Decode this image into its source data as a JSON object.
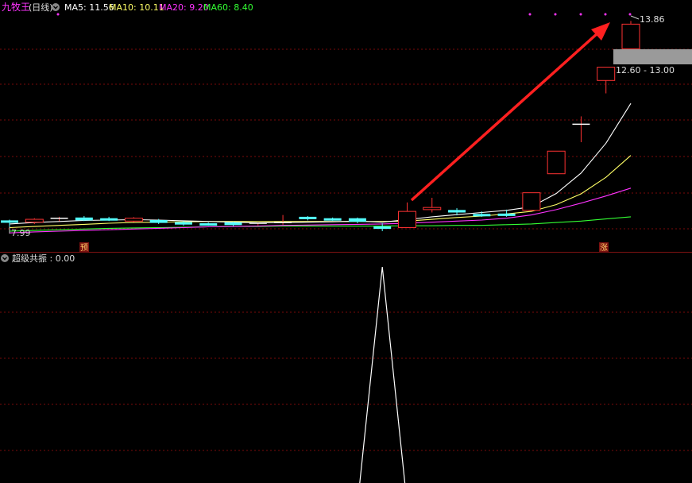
{
  "main_panel": {
    "stock_name": "九牧王",
    "period": "(日线)",
    "ma_labels": [
      {
        "text": "MA5: 11.56",
        "color": "#ffffff"
      },
      {
        "text": "MA10: 10.11",
        "color": "#ffff66"
      },
      {
        "text": "MA20: 9.20",
        "color": "#ff33ff"
      },
      {
        "text": "MA60: 8.40",
        "color": "#33ff33"
      }
    ],
    "high_label": "13.86",
    "low_label": "7.99",
    "range_label": "12.60 - 13.00",
    "marker_yu": "预",
    "marker_zhang": "涨"
  },
  "indicator_panel": {
    "title": "超级共振 : 0.00"
  },
  "colors": {
    "up": "#ff3232",
    "down": "#54ffff",
    "ma5": "#ffffff",
    "ma10": "#ffff66",
    "ma20": "#ff33ff",
    "ma60": "#33ff33",
    "grid": "#7a0a0a",
    "arrow": "#ff2020",
    "name": "#ff33ff"
  },
  "chart_data": [
    {
      "type": "candlestick",
      "price_axis_range": [
        7.8,
        14.0
      ],
      "candles": [
        {
          "o": 8.3,
          "c": 8.25,
          "h": 8.32,
          "l": 7.99
        },
        {
          "o": 8.25,
          "c": 8.33,
          "h": 8.36,
          "l": 8.2
        },
        {
          "o": 8.34,
          "c": 8.36,
          "h": 8.4,
          "l": 8.28
        },
        {
          "o": 8.38,
          "c": 8.3,
          "h": 8.42,
          "l": 8.28
        },
        {
          "o": 8.36,
          "c": 8.32,
          "h": 8.4,
          "l": 8.28
        },
        {
          "o": 8.28,
          "c": 8.36,
          "h": 8.39,
          "l": 8.25
        },
        {
          "o": 8.31,
          "c": 8.23,
          "h": 8.34,
          "l": 8.2
        },
        {
          "o": 8.25,
          "c": 8.2,
          "h": 8.28,
          "l": 8.15
        },
        {
          "o": 8.22,
          "c": 8.2,
          "h": 8.24,
          "l": 8.15
        },
        {
          "o": 8.24,
          "c": 8.17,
          "h": 8.26,
          "l": 8.14
        },
        {
          "o": 8.19,
          "c": 8.22,
          "h": 8.24,
          "l": 8.16
        },
        {
          "o": 8.22,
          "c": 8.24,
          "h": 8.45,
          "l": 8.18
        },
        {
          "o": 8.4,
          "c": 8.34,
          "h": 8.42,
          "l": 8.3
        },
        {
          "o": 8.36,
          "c": 8.32,
          "h": 8.38,
          "l": 8.29
        },
        {
          "o": 8.36,
          "c": 8.26,
          "h": 8.38,
          "l": 8.22
        },
        {
          "o": 8.13,
          "c": 8.07,
          "h": 8.22,
          "l": 8.0
        },
        {
          "o": 8.1,
          "c": 8.55,
          "h": 8.8,
          "l": 8.1
        },
        {
          "o": 8.6,
          "c": 8.66,
          "h": 8.93,
          "l": 8.52
        },
        {
          "o": 8.59,
          "c": 8.52,
          "h": 8.64,
          "l": 8.44
        },
        {
          "o": 8.48,
          "c": 8.47,
          "h": 8.55,
          "l": 8.4
        },
        {
          "o": 8.49,
          "c": 8.44,
          "h": 8.6,
          "l": 8.4
        },
        {
          "o": 8.58,
          "c": 9.07,
          "h": 9.07,
          "l": 8.58
        },
        {
          "o": 9.6,
          "c": 10.23,
          "h": 10.23,
          "l": 9.6
        },
        {
          "o": 10.98,
          "c": 10.98,
          "h": 11.2,
          "l": 10.48
        },
        {
          "o": 12.2,
          "c": 12.57,
          "h": 12.57,
          "l": 11.84
        },
        {
          "o": 13.08,
          "c": 13.77,
          "h": 13.86,
          "l": 13.08
        }
      ],
      "ma5": [
        8.2,
        8.24,
        8.27,
        8.3,
        8.31,
        8.32,
        8.31,
        8.29,
        8.27,
        8.25,
        8.23,
        8.24,
        8.25,
        8.26,
        8.28,
        8.25,
        8.32,
        8.4,
        8.46,
        8.52,
        8.58,
        8.68,
        9.05,
        9.62,
        10.45,
        11.56
      ],
      "ma10": [
        8.1,
        8.13,
        8.16,
        8.19,
        8.22,
        8.24,
        8.25,
        8.26,
        8.27,
        8.27,
        8.27,
        8.27,
        8.27,
        8.27,
        8.27,
        8.27,
        8.28,
        8.33,
        8.38,
        8.42,
        8.48,
        8.55,
        8.74,
        9.04,
        9.5,
        10.11
      ],
      "ma20": [
        7.95,
        7.98,
        8.0,
        8.02,
        8.04,
        8.06,
        8.08,
        8.1,
        8.12,
        8.13,
        8.14,
        8.16,
        8.17,
        8.18,
        8.19,
        8.2,
        8.22,
        8.25,
        8.28,
        8.31,
        8.36,
        8.45,
        8.6,
        8.78,
        8.98,
        9.2
      ],
      "ma60": [
        8.0,
        8.02,
        8.04,
        8.06,
        8.08,
        8.09,
        8.1,
        8.11,
        8.12,
        8.13,
        8.13,
        8.14,
        8.14,
        8.14,
        8.14,
        8.14,
        8.15,
        8.15,
        8.16,
        8.16,
        8.18,
        8.2,
        8.24,
        8.28,
        8.34,
        8.4
      ]
    },
    {
      "type": "line",
      "series": [
        {
          "values": [
            0,
            0,
            0,
            0,
            0,
            0,
            0,
            0,
            0,
            0,
            0,
            0,
            0,
            0,
            0,
            1,
            0,
            0,
            0,
            0,
            0,
            0,
            0,
            0,
            0,
            0
          ]
        }
      ]
    }
  ]
}
